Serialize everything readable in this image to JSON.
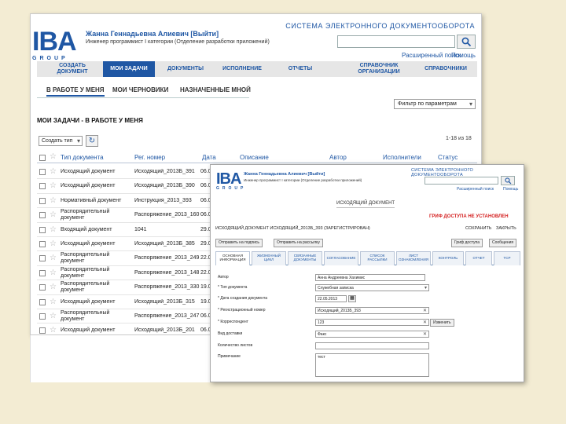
{
  "main": {
    "user_name": "Жанна Геннадьевна Алиевич [Выйти]",
    "organization": "Инженер программист I категории (Отделение разработки приложений)",
    "system_title": "СИСТЕМА ЭЛЕКТРОННОГО ДОКУМЕНТООБОРОТА",
    "search_placeholder": "",
    "advanced_search": "Расширенный поиск",
    "help": "Помощь",
    "nav": [
      {
        "label": "СОЗДАТЬ ДОКУМЕНТ"
      },
      {
        "label": "МОИ ЗАДАЧИ"
      },
      {
        "label": "ДОКУМЕНТЫ"
      },
      {
        "label": "ИСПОЛНЕНИЕ"
      },
      {
        "label": "ОТЧЕТЫ"
      },
      {
        "label": "СПРАВОЧНИК ОРГАНИЗАЦИИ"
      },
      {
        "label": "СПРАВОЧНИКИ"
      }
    ],
    "subtabs": [
      {
        "label": "В РАБОТЕ У МЕНЯ"
      },
      {
        "label": "МОИ ЧЕРНОВИКИ"
      },
      {
        "label": "НАЗНАЧЕННЫЕ МНОЙ"
      }
    ],
    "filter_label": "Фильтр по параметрам",
    "page_heading": "МОИ ЗАДАЧИ - В РАБОТЕ У МЕНЯ",
    "create_label": "Создать тип",
    "paging": "1-18 из 18",
    "columns": [
      "Тип документа",
      "Рег. номер",
      "Дата",
      "Описание",
      "Автор",
      "Исполнители",
      "Статус"
    ],
    "rows": [
      {
        "type": "Исходящий документ",
        "reg": "Исходящий_2013Б_391",
        "date": "06.0"
      },
      {
        "type": "Исходящий документ",
        "reg": "Исходящий_2013Б_390",
        "date": "06.0"
      },
      {
        "type": "Нормативный документ",
        "reg": "Инструкция_2013_393",
        "date": "06.0"
      },
      {
        "type": "Распорядительный документ",
        "reg": "Распоряжение_2013_160",
        "date": "06.0"
      },
      {
        "type": "Входящий документ",
        "reg": "1041",
        "date": "29.0"
      },
      {
        "type": "Исходящий документ",
        "reg": "Исходящий_2013Б_385",
        "date": "29.0"
      },
      {
        "type": "Распорядительный документ",
        "reg": "Распоряжение_2013_249",
        "date": "22.0"
      },
      {
        "type": "Распорядительный документ",
        "reg": "Распоряжение_2013_148",
        "date": "22.0"
      },
      {
        "type": "Распорядительный документ",
        "reg": "Распоряжение_2013_330",
        "date": "19.0"
      },
      {
        "type": "Исходящий документ",
        "reg": "Исходящий_2013Б_315",
        "date": "19.0"
      },
      {
        "type": "Распорядительный документ",
        "reg": "Распоряжение_2013_247",
        "date": "06.0"
      },
      {
        "type": "Исходящий документ",
        "reg": "Исходящий_2013Б_201",
        "date": "06.0"
      }
    ]
  },
  "detail": {
    "user_name": "Жанна Геннадьевна Алиевич [Выйти]",
    "organization": "Инженер программист I категории (Отделение разработки приложений)",
    "system_title": "СИСТЕМА ЭЛЕКТРОННОГО ДОКУМЕНТООБОРОТА",
    "advanced_search": "Расширенный поиск",
    "help": "Помощь",
    "doc_title": "ИСХОДЯЩИЙ ДОКУМЕНТ",
    "grif": "ГРИФ ДОСТУПА НЕ УСТАНОВЛЕН",
    "heading": "ИСХОДЯЩИЙ ДОКУМЕНТ ИСХОДЯЩИЙ_2013Б_393 (ЗАРЕГИСТРИРОВАН)",
    "save": "СОХРАНИТЬ",
    "close": "ЗАКРЫТЬ",
    "buttons": [
      "Отправить на подпись",
      "Отправить на рассылку",
      "Гриф доступа",
      "Сообщения"
    ],
    "tabs": [
      {
        "label": "ОСНОВНАЯ ИНФОРМАЦИЯ"
      },
      {
        "label": "ЖИЗНЕННЫЙ ЦИКЛ"
      },
      {
        "label": "СВЯЗАННЫЕ ДОКУМЕНТЫ"
      },
      {
        "label": "СОГЛАСОВАНИЕ"
      },
      {
        "label": "СПИСОК РАССЫЛКИ"
      },
      {
        "label": "ЛИСТ ОЗНАКОМЛЕНИЯ"
      },
      {
        "label": "КОНТРОЛЬ"
      },
      {
        "label": "ОТЧЕТ"
      },
      {
        "label": "ТСР"
      }
    ],
    "fields": [
      {
        "label": "Автор",
        "value": "Анна Андреевна Хахимис"
      },
      {
        "label": "* Тип документа",
        "value": "Служебная записка"
      },
      {
        "label": "* Дата создания документа",
        "value": "22.05.2013"
      },
      {
        "label": "* Регистрационный номер",
        "value": "Исходящий_2013Б_393"
      },
      {
        "label": "* Корреспондент",
        "value": "123"
      },
      {
        "label": "Вид доставки",
        "value": "Факс"
      },
      {
        "label": "Количество листов",
        "value": ""
      },
      {
        "label": "Примечание",
        "value": "тест"
      }
    ],
    "change_button": "Изменить"
  }
}
